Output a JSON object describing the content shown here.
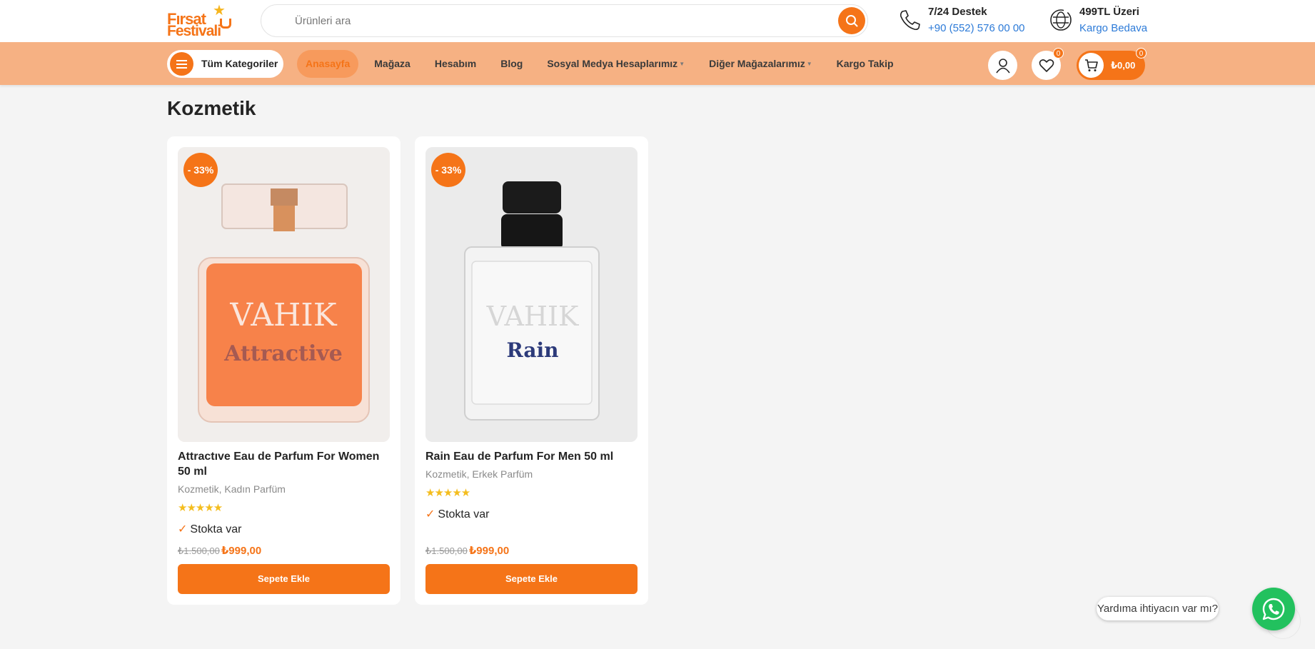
{
  "header": {
    "logo_line1": "Fırsat",
    "logo_line2": "Festivali",
    "search_placeholder": "Ürünleri ara",
    "support": {
      "title": "7/24 Destek",
      "phone": "+90 (552) 576 00 00"
    },
    "shipping": {
      "title": "499TL Üzeri",
      "subtitle": "Kargo Bedava"
    }
  },
  "nav": {
    "all_categories": "Tüm Kategoriler",
    "items": [
      {
        "label": "Anasayfa",
        "active": true,
        "dropdown": false
      },
      {
        "label": "Mağaza",
        "active": false,
        "dropdown": false
      },
      {
        "label": "Hesabım",
        "active": false,
        "dropdown": false
      },
      {
        "label": "Blog",
        "active": false,
        "dropdown": false
      },
      {
        "label": "Sosyal Medya Hesaplarımız",
        "active": false,
        "dropdown": true
      },
      {
        "label": "Diğer Mağazalarımız",
        "active": false,
        "dropdown": true
      },
      {
        "label": "Kargo Takip",
        "active": false,
        "dropdown": false
      }
    ],
    "wishlist_count": "0",
    "cart_count": "0",
    "cart_total": "₺0,00"
  },
  "page": {
    "title": "Kozmetik"
  },
  "products": [
    {
      "name": "Attractıve Eau de Parfum For Women 50 ml",
      "discount": "- 33%",
      "categories": [
        "Kozmetik",
        "Kadın Parfüm"
      ],
      "categories_text": "Kozmetik, Kadın Parfüm",
      "rating": 5,
      "stars": "★★★★★",
      "stock": "Stokta var",
      "old_price": "₺1.500,00",
      "price": "₺999,00",
      "button": "Sepete Ekle",
      "bottle_brand": "VAHIK",
      "bottle_name": "Attractive"
    },
    {
      "name": "Rain Eau de Parfum For Men 50 ml",
      "discount": "- 33%",
      "categories": [
        "Kozmetik",
        "Erkek Parfüm"
      ],
      "categories_text": "Kozmetik, Erkek Parfüm",
      "rating": 5,
      "stars": "★★★★★",
      "stock": "Stokta var",
      "old_price": "₺1.500,00",
      "price": "₺999,00",
      "button": "Sepete Ekle",
      "bottle_brand": "VAHIK",
      "bottle_name": "Rain"
    }
  ],
  "help": {
    "text": "Yardıma ihtiyacın var mı?"
  },
  "colors": {
    "accent": "#f57418",
    "nav_bg": "#f6b183",
    "link": "#2d7bd8",
    "whatsapp": "#22c15e",
    "star": "#f4bd1e"
  },
  "icons": [
    "search-icon",
    "phone-icon",
    "globe-icon",
    "menu-icon",
    "user-icon",
    "heart-icon",
    "cart-icon",
    "check-icon",
    "whatsapp-icon"
  ]
}
